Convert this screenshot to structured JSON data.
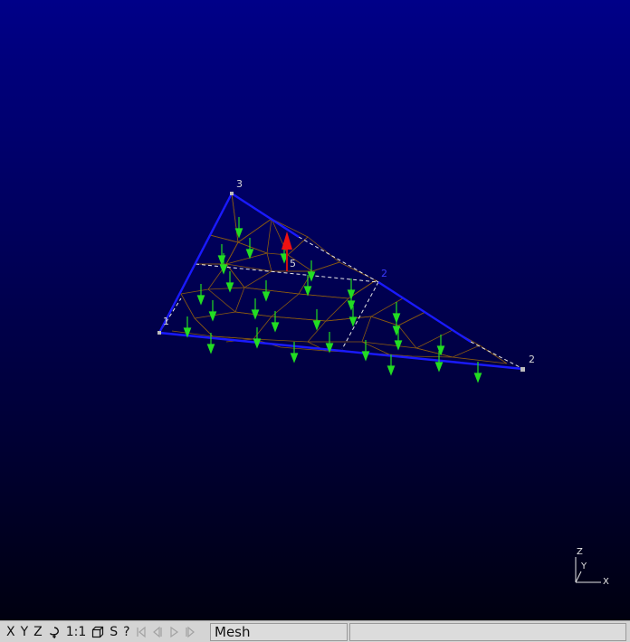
{
  "viewport": {
    "background_top": "#000088",
    "background_bottom": "#000010",
    "vertex_labels": [
      "1",
      "2",
      "3",
      "5",
      "2"
    ],
    "edge_color": "#1a1aff",
    "mesh_color": "#8a5a10",
    "load_arrow_color": "#22dd22",
    "normal_arrow_color": "#ee1111"
  },
  "axes": {
    "z": "Z",
    "y": "Y",
    "x": "X"
  },
  "toolbar": {
    "x_label": "X",
    "y_label": "Y",
    "z_label": "Z",
    "rotate_icon": "rotate-icon",
    "scale_label": "1:1",
    "ortho_icon": "projection-cube-icon",
    "s_label": "S",
    "help_label": "?",
    "first_icon": "first-step-icon",
    "prev_icon": "previous-step-icon",
    "play_icon": "play-icon",
    "next_icon": "next-step-icon"
  },
  "status": {
    "message": "Mesh",
    "secondary": ""
  }
}
